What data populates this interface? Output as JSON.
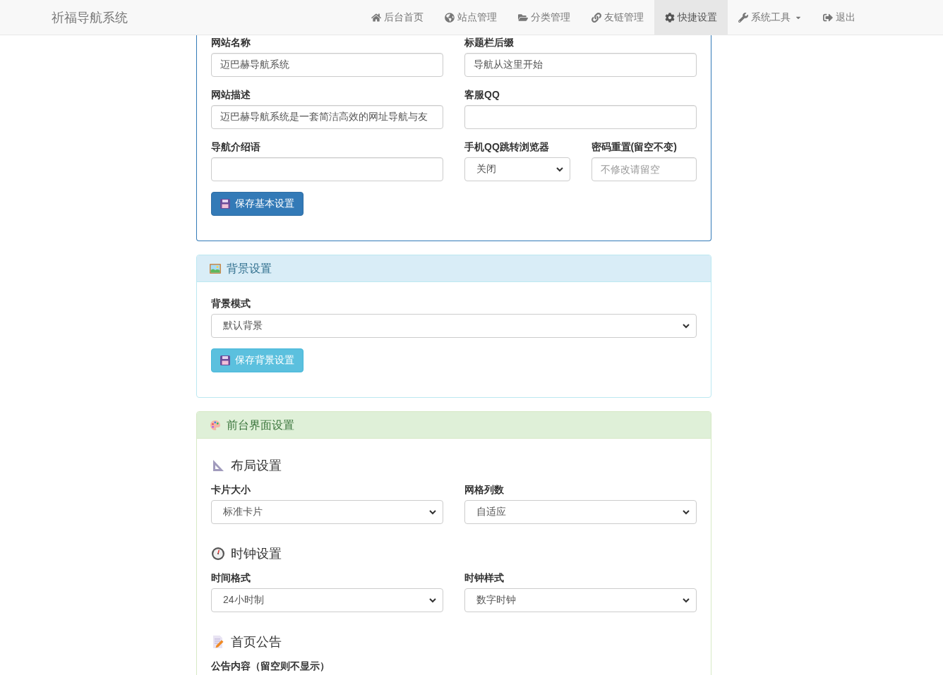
{
  "navbar": {
    "brand": "祈福导航系统",
    "items": [
      {
        "label": "后台首页",
        "kind": "link",
        "selected": false
      },
      {
        "label": "站点管理",
        "kind": "link",
        "selected": false
      },
      {
        "label": "分类管理",
        "kind": "link",
        "selected": false
      },
      {
        "label": "友链管理",
        "kind": "link",
        "selected": false
      },
      {
        "label": "快捷设置",
        "kind": "link",
        "selected": true
      },
      {
        "label": "系统工具",
        "kind": "dropdown",
        "selected": false
      },
      {
        "label": "退出",
        "kind": "link",
        "selected": false
      }
    ]
  },
  "panels": [
    {
      "kind": "primary",
      "rows": [
        {
          "columns": [
            {
              "fields": [
                {
                  "label": "网站名称",
                  "kind": "input",
                  "value": "迈巴赫导航系统"
                }
              ]
            },
            {
              "fields": [
                {
                  "label": "标题栏后缀",
                  "kind": "input",
                  "value": "导航从这里开始"
                }
              ]
            }
          ]
        },
        {
          "columns": [
            {
              "fields": [
                {
                  "label": "网站描述",
                  "kind": "input",
                  "value": "迈巴赫导航系统是一套简洁高效的网址导航与友"
                }
              ]
            },
            {
              "fields": [
                {
                  "label": "客服QQ",
                  "kind": "input"
                }
              ]
            }
          ]
        },
        {
          "columns": [
            {
              "fields": [
                {
                  "label": "导航介绍语",
                  "kind": "input"
                }
              ]
            },
            {
              "fields": [
                {
                  "label": "手机QQ跳转浏览器",
                  "kind": "select",
                  "value": "关闭"
                },
                {
                  "label": "密码重置(留空不变)",
                  "kind": "password",
                  "placeholder": "不修改请留空"
                }
              ]
            }
          ]
        }
      ],
      "button": {
        "label": "保存基本设置"
      }
    },
    {
      "kind": "info",
      "title": "背景设置",
      "rows": [
        {
          "columns": [
            {
              "fields": [
                {
                  "label": "背景模式",
                  "kind": "select",
                  "value": "默认背景"
                }
              ]
            }
          ]
        }
      ],
      "button": {
        "label": "保存背景设置"
      }
    },
    {
      "kind": "success",
      "title": "前台界面设置",
      "sections": [
        {
          "title": "布局设置",
          "rows": [
            {
              "columns": [
                {
                  "fields": [
                    {
                      "label": "卡片大小",
                      "kind": "select",
                      "value": "标准卡片"
                    }
                  ]
                },
                {
                  "fields": [
                    {
                      "label": "网格列数",
                      "kind": "select",
                      "value": "自适应"
                    }
                  ]
                }
              ]
            }
          ]
        },
        {
          "title": "时钟设置",
          "rows": [
            {
              "columns": [
                {
                  "fields": [
                    {
                      "label": "时间格式",
                      "kind": "select",
                      "value": "24小时制"
                    }
                  ]
                },
                {
                  "fields": [
                    {
                      "label": "时钟样式",
                      "kind": "select",
                      "value": "数字时钟"
                    }
                  ]
                }
              ]
            }
          ]
        },
        {
          "title": "首页公告",
          "rows": [
            {
              "columns": [
                {
                  "fields": [
                    {
                      "label": "公告内容（留空则不显示）"
                    }
                  ]
                }
              ]
            }
          ]
        }
      ]
    }
  ]
}
